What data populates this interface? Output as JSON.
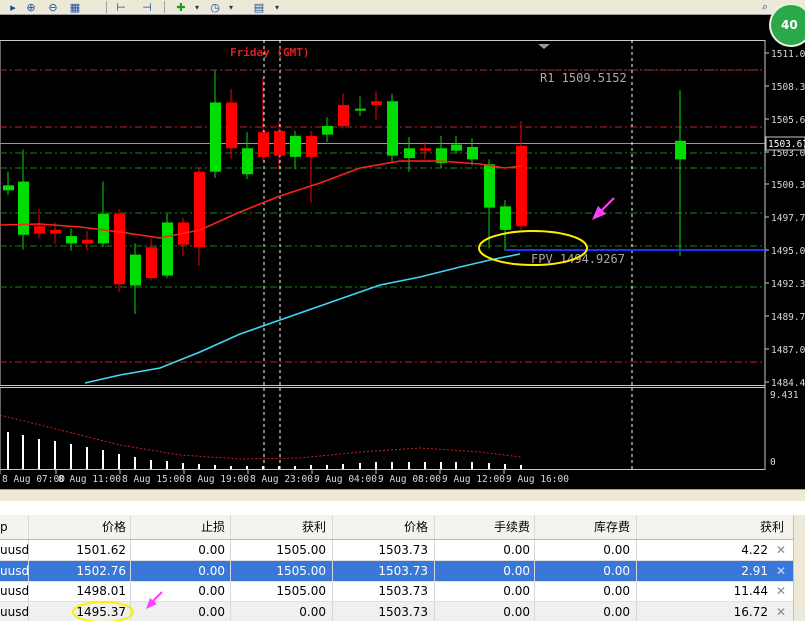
{
  "toolbar": {
    "status_badge": "40"
  },
  "chart": {
    "session_label": "Friday",
    "tz_label": "(GMT)",
    "pivots": [
      {
        "name": "R1",
        "value": "1509.5152"
      },
      {
        "name": "FPV",
        "value": "1494.9267"
      }
    ],
    "price_axis": [
      "1511.00",
      "1508.30",
      "1505.65",
      "1503.05",
      "1500.35",
      "1497.70",
      "1495.00",
      "1492.35",
      "1489.70",
      "1487.05",
      "1484.40"
    ],
    "current_price": "1503.67",
    "indicator_axis": [
      "9.431",
      "0"
    ],
    "time_axis": [
      "8 Aug 07:00",
      "8 Aug 11:00",
      "8 Aug 15:00",
      "8 Aug 19:00",
      "8 Aug 23:00",
      "9 Aug 04:00",
      "9 Aug 08:00",
      "9 Aug 12:00",
      "9 Aug 16:00"
    ],
    "colors": {
      "bull": "#00dd00",
      "bear": "#ff0000",
      "ma_fast": "#ff2020",
      "ma_slow": "#40d8f0",
      "pivot_line": "#2030ff",
      "highlight": "#ffee00",
      "arrow": "#ff40ff"
    }
  },
  "trades": {
    "headers": [
      "价格",
      "止损",
      "获利",
      "价格",
      "手续费",
      "库存费",
      "获利"
    ],
    "rows": [
      {
        "symbol": "uusd",
        "price": "1501.62",
        "sl": "0.00",
        "tp": "1505.00",
        "cur": "1503.73",
        "fee": "0.00",
        "swap": "0.00",
        "profit": "4.22"
      },
      {
        "symbol": "uusd",
        "price": "1502.76",
        "sl": "0.00",
        "tp": "1505.00",
        "cur": "1503.73",
        "fee": "0.00",
        "swap": "0.00",
        "profit": "2.91"
      },
      {
        "symbol": "uusd",
        "price": "1498.01",
        "sl": "0.00",
        "tp": "1505.00",
        "cur": "1503.73",
        "fee": "0.00",
        "swap": "0.00",
        "profit": "11.44"
      },
      {
        "symbol": "uusd",
        "price": "1495.37",
        "sl": "0.00",
        "tp": "0.00",
        "cur": "1503.73",
        "fee": "0.00",
        "swap": "0.00",
        "profit": "16.72"
      }
    ],
    "close_glyph": "✕",
    "hdr_prefix": "p"
  }
}
